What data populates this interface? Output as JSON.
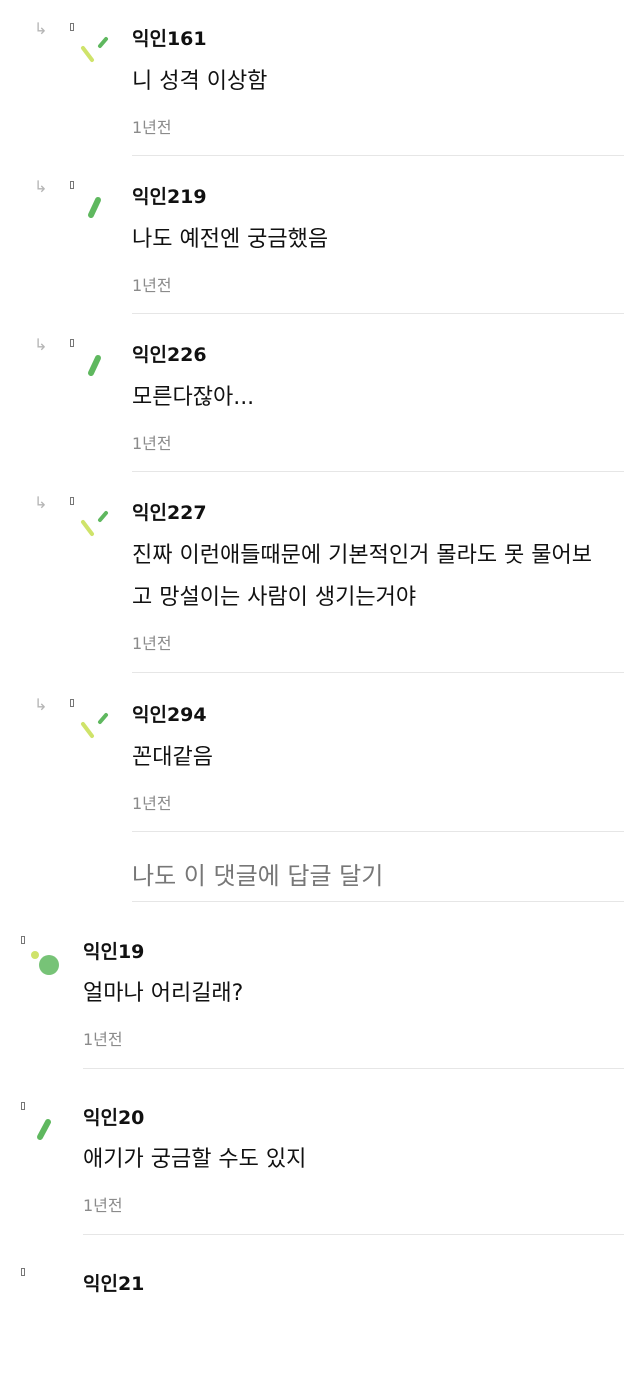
{
  "colors": {
    "text": "#111111",
    "muted": "#8b8b8b",
    "divider": "#e6e6e6",
    "avatar_green": "#5fb85f",
    "avatar_lime": "#cfe36a"
  },
  "replies": [
    {
      "name": "익인161",
      "text": [
        "니 성격 이상함"
      ],
      "time": "1년전",
      "avatar_icon": "sparkle-avatar-icon"
    },
    {
      "name": "익인219",
      "text": [
        "나도 예전엔 궁금했음"
      ],
      "time": "1년전",
      "avatar_icon": "leaf-avatar-icon"
    },
    {
      "name": "익인226",
      "text": [
        "모른다잖아..."
      ],
      "time": "1년전",
      "avatar_icon": "leaf-avatar-icon"
    },
    {
      "name": "익인227",
      "text": [
        "진짜 이런애들때문에 기본적인거 몰라도 못 물어보",
        "고 망설이는 사람이 생기는거야"
      ],
      "time": "1년전",
      "avatar_icon": "sparkle-avatar-icon"
    },
    {
      "name": "익인294",
      "text": [
        "꼰대같음"
      ],
      "time": "1년전",
      "avatar_icon": "sparkle-avatar-icon"
    }
  ],
  "reply_prompt": "나도 이 댓글에 답글 달기",
  "comments": [
    {
      "name": "익인19",
      "text": "얼마나 어리길래?",
      "time": "1년전",
      "avatar_icon": "dot-avatar-icon"
    },
    {
      "name": "익인20",
      "text": "애기가 궁금할 수도 있지",
      "time": "1년전",
      "avatar_icon": "leaf-avatar-icon"
    },
    {
      "name": "익인21",
      "text": "",
      "time": "",
      "avatar_icon": ""
    }
  ]
}
